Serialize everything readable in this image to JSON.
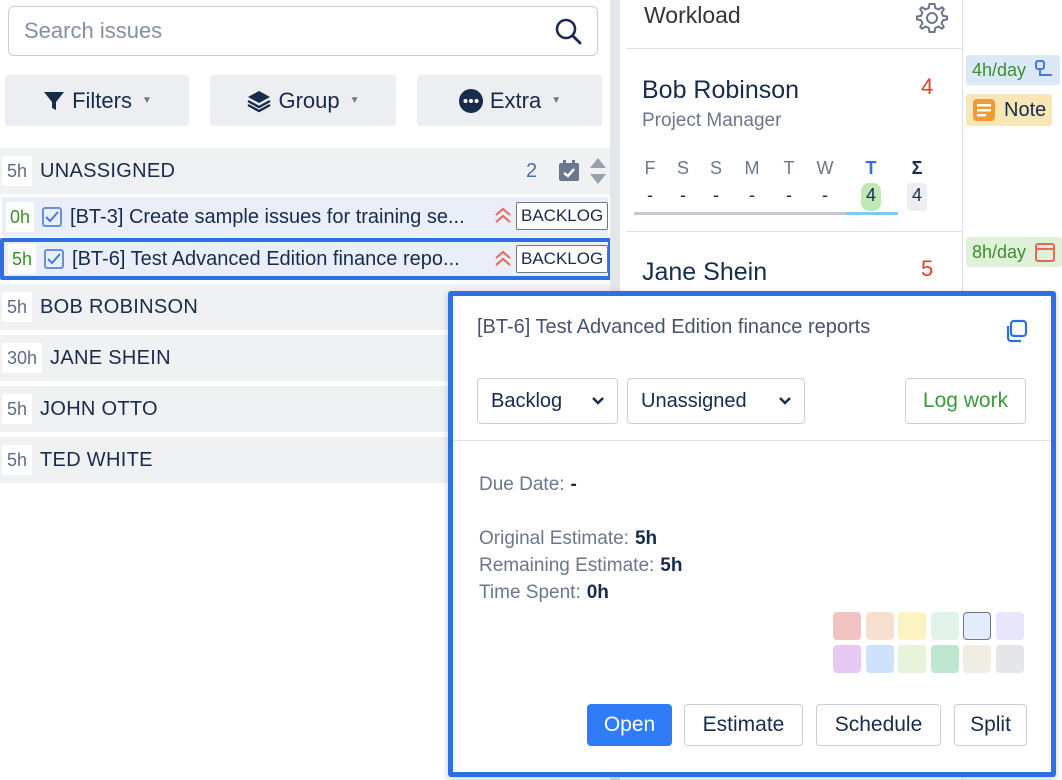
{
  "search": {
    "placeholder": "Search issues"
  },
  "toolbar": {
    "filters_label": "Filters",
    "group_label": "Group",
    "extra_label": "Extra"
  },
  "groups": [
    {
      "hours": "5h",
      "name": "UNASSIGNED",
      "count": "2"
    },
    {
      "hours": "5h",
      "name": "BOB ROBINSON"
    },
    {
      "hours": "30h",
      "name": "JANE SHEIN"
    },
    {
      "hours": "5h",
      "name": "JOHN OTTO"
    },
    {
      "hours": "5h",
      "name": "TED WHITE"
    }
  ],
  "issues": [
    {
      "hours": "0h",
      "title": "[BT-3] Create sample issues for training se...",
      "status": "BACKLOG"
    },
    {
      "hours": "5h",
      "title": "[BT-6] Test Advanced Edition finance repo...",
      "status": "BACKLOG"
    }
  ],
  "workload": {
    "title": "Workload",
    "users": [
      {
        "name": "Bob Robinson",
        "role": "Project Manager",
        "count": "4",
        "days": [
          "F",
          "S",
          "S",
          "M",
          "T",
          "W",
          "T",
          "Σ"
        ],
        "values": [
          "-",
          "-",
          "-",
          "-",
          "-",
          "-",
          "4",
          "4"
        ],
        "rate": "4h/day",
        "note": "Note"
      },
      {
        "name": "Jane Shein",
        "count": "5",
        "rate": "8h/day"
      }
    ]
  },
  "popup": {
    "title": "[BT-6] Test Advanced Edition finance reports",
    "status_select": "Backlog",
    "assignee_select": "Unassigned",
    "log_work_label": "Log work",
    "due_date_label": "Due Date:",
    "due_date_value": "-",
    "original_estimate_label": "Original Estimate:",
    "original_estimate_value": "5h",
    "remaining_estimate_label": "Remaining Estimate:",
    "remaining_estimate_value": "5h",
    "time_spent_label": "Time Spent:",
    "time_spent_value": "0h",
    "swatches": [
      "#f2c3c3",
      "#f7e0cf",
      "#fbf3c1",
      "#dff3e8",
      "#e3ecfa",
      "#e7e6fb",
      "#e8c9f3",
      "#cfe0fb",
      "#e6f2da",
      "#bfe6cf",
      "#f1ede3",
      "#e4e6ea"
    ],
    "open_label": "Open",
    "estimate_label": "Estimate",
    "schedule_label": "Schedule",
    "split_label": "Split"
  },
  "colors": {
    "accent": "#2f6fe4",
    "primary_button": "#2f7cf6",
    "count_red": "#e23c2a",
    "hours_green": "#3b8f2a"
  }
}
